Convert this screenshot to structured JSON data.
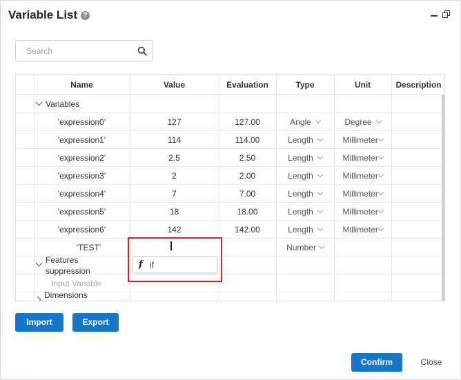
{
  "dialog": {
    "title": "Variable List",
    "help_icon": "?",
    "icons": {
      "help": "question-circle-icon",
      "minimize": "minimize-icon",
      "restore": "restore-window-icon",
      "search": "magnifier-icon",
      "function": "function-f-icon"
    }
  },
  "search": {
    "placeholder": "Search",
    "value": ""
  },
  "table": {
    "columns": [
      "Name",
      "Value",
      "Evaluation",
      "Type",
      "Unit",
      "Description"
    ],
    "groups": {
      "variables": "Variables",
      "features_line1": "Features",
      "features_line2": "suppression",
      "dimensions": "Dimensions"
    },
    "rows": [
      {
        "name": "'expression0'",
        "value": "127",
        "evaluation": "127.00",
        "type": "Angle",
        "unit": "Degree"
      },
      {
        "name": "'expression1'",
        "value": "114",
        "evaluation": "114.00",
        "type": "Length",
        "unit": "Millimeter"
      },
      {
        "name": "'expression2'",
        "value": "2.5",
        "evaluation": "2.50",
        "type": "Length",
        "unit": "Millimeter"
      },
      {
        "name": "'expression3'",
        "value": "2",
        "evaluation": "2.00",
        "type": "Length",
        "unit": "Millimeter"
      },
      {
        "name": "'expression4'",
        "value": "7",
        "evaluation": "7.00",
        "type": "Length",
        "unit": "Millimeter"
      },
      {
        "name": "'expression5'",
        "value": "18",
        "evaluation": "18.00",
        "type": "Length",
        "unit": "Millimeter"
      },
      {
        "name": "'expression6'",
        "value": "142",
        "evaluation": "142.00",
        "type": "Length",
        "unit": "Millimeter"
      }
    ],
    "new_row": {
      "name": "'TEST'",
      "value": "",
      "type": "Number"
    },
    "input_variable": "Input Variable",
    "autocomplete": {
      "icon": "f",
      "label": "if"
    }
  },
  "buttons": {
    "import": "Import",
    "export": "Export",
    "confirm": "Confirm",
    "close": "Close"
  },
  "colors": {
    "primary": "#1677c9",
    "highlight_box": "#e02020"
  }
}
